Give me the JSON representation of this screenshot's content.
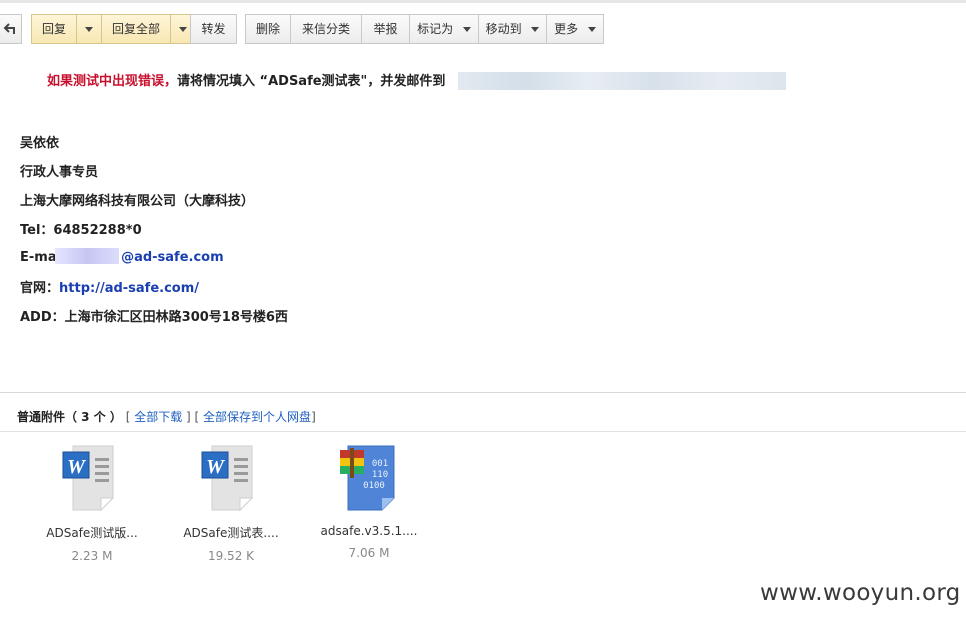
{
  "toolbar": {
    "reply": "回复",
    "reply_all": "回复全部",
    "forward": "转发",
    "delete": "删除",
    "classify": "来信分类",
    "report": "举报",
    "mark_as": "标记为",
    "move_to": "移动到",
    "more": "更多"
  },
  "message": {
    "notice_red": "如果测试中出现错误，",
    "notice_black": "请将情况填入 “ADSafe测试表\"，并发邮件到",
    "signature": {
      "name": "吴依依",
      "title": "行政人事专员",
      "company": "上海大摩网络科技有限公司（大摩科技）",
      "tel": "Tel：64852288*0",
      "email_prefix": "E-mai",
      "email_domain": "@ad-safe.com",
      "website_label": "官网：",
      "website_url": "http://ad-safe.com/",
      "address": "ADD：上海市徐汇区田林路300号18号楼6西"
    }
  },
  "attachments": {
    "header_title": "普通附件（ 3 个 ）",
    "download_all": "全部下载",
    "save_all": "全部保存到个人网盘",
    "files": [
      {
        "name": "ADSafe测试版...",
        "size": "2.23 M",
        "icon": "word-document-icon"
      },
      {
        "name": "ADSafe测试表....",
        "size": "19.52 K",
        "icon": "word-document-icon"
      },
      {
        "name": "adsafe.v3.5.1....",
        "size": "7.06 M",
        "icon": "archive-binary-icon"
      }
    ]
  },
  "watermark": "www.wooyun.org",
  "colors": {
    "notice_red": "#c8102e",
    "link_blue": "#1a3fb0",
    "highlight_button": "#f7e7b2"
  }
}
